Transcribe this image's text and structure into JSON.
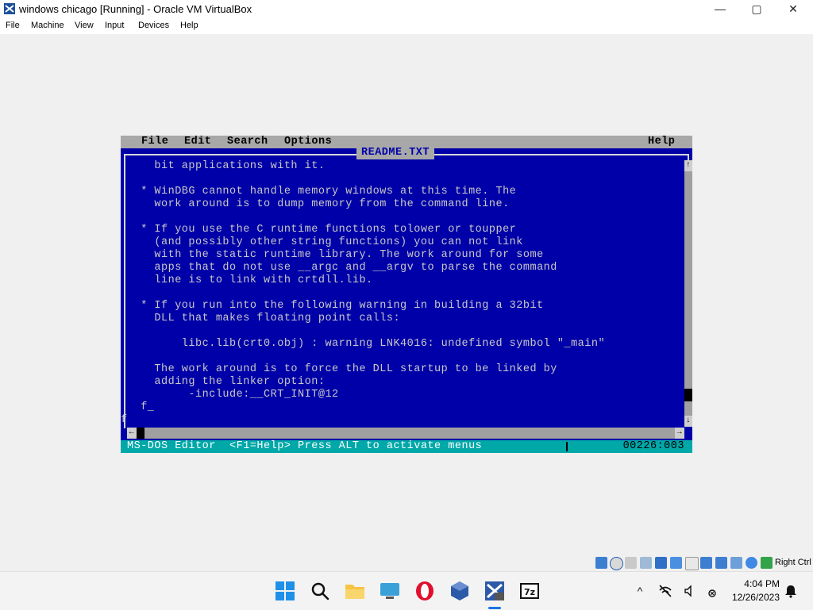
{
  "window": {
    "title": "windows chicago [Running] - Oracle VM VirtualBox",
    "minimize_glyph": "—",
    "maximize_glyph": "▢",
    "close_glyph": "✕"
  },
  "host_menu": [
    "File",
    "Machine",
    "View",
    "Input",
    "Devices",
    "Help"
  ],
  "dos": {
    "menu": {
      "file": "File",
      "edit": "Edit",
      "search": "Search",
      "options": "Options",
      "help": "Help"
    },
    "document_title": "README.TXT",
    "lines": [
      "    bit applications with it.",
      "",
      "  * WinDBG cannot handle memory windows at this time. The",
      "    work around is to dump memory from the command line.",
      "",
      "  * If you use the C runtime functions tolower or toupper",
      "    (and possibly other string functions) you can not link",
      "    with the static runtime library. The work around for some",
      "    apps that do not use __argc and __argv to parse the command",
      "    line is to link with crtdll.lib.",
      "",
      "  * If you run into the following warning in building a 32bit",
      "    DLL that makes floating point calls:",
      "",
      "        libc.lib(crt0.obj) : warning LNK4016: undefined symbol \"_main\"",
      "",
      "    The work around is to force the DLL startup to be linked by",
      "    adding the linker option:",
      "         -include:__CRT_INIT@12",
      "  f_",
      "f"
    ],
    "scroll_up": "↑",
    "scroll_down": "↓",
    "scroll_left": "←",
    "scroll_right": "→",
    "status_text": "MS-DOS Editor  <F1=Help> Press ALT to activate menus",
    "cursor_position": "00226:003"
  },
  "vbox_status": {
    "right_ctrl": "Right Ctrl"
  },
  "taskbar": {
    "time": "4:04 PM",
    "date": "12/26/2023",
    "chevron": "^"
  }
}
